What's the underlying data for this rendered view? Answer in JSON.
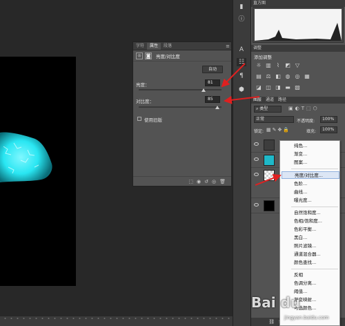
{
  "properties_panel": {
    "tabs": [
      "字符",
      "属性",
      "段落"
    ],
    "active_tab": "属性",
    "title": "亮度/对比度",
    "auto_label": "自动",
    "brightness_label": "亮度：",
    "brightness_value": "81",
    "contrast_label": "对比度：",
    "contrast_value": "85",
    "legacy_label": "使用旧版"
  },
  "right_panels": {
    "histogram_tab": "直方图",
    "adjustments_tab": "调整",
    "adjustments_hint": "添加调整",
    "layer_tabs": [
      "图层",
      "通道",
      "路径"
    ],
    "kind_filter": "类型",
    "blend_mode": "正常",
    "opacity_label": "不透明度:",
    "opacity_value": "100%",
    "lock_label": "锁定:",
    "fill_label": "填充:",
    "fill_value": "100%"
  },
  "menu": {
    "items": [
      "纯色...",
      "渐变...",
      "图案...",
      "亮度/对比度...",
      "色阶...",
      "曲线...",
      "曝光度...",
      "自然饱和度...",
      "色相/饱和度...",
      "色彩平衡...",
      "黑白...",
      "照片滤镜...",
      "通道混合器...",
      "颜色查找...",
      "反相",
      "色调分离...",
      "阈值...",
      "渐变映射...",
      "可选颜色..."
    ],
    "highlighted": "亮度/对比度..."
  },
  "watermark": {
    "brand": "Bai du",
    "sub": "jingyan.baidu.com"
  },
  "colors": {
    "accent_red": "#e02020",
    "panel_bg": "#535353",
    "menu_highlight": "#dce6f5",
    "blob_cyan": "#29e6f2"
  }
}
